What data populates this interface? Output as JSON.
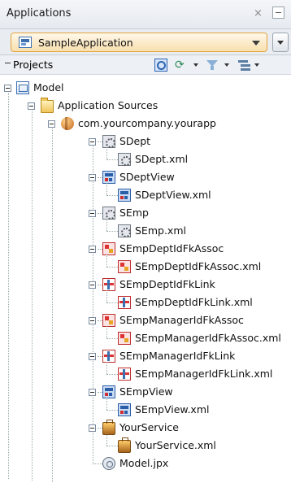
{
  "panel": {
    "title": "Applications",
    "close_glyph": "×"
  },
  "application_selector": {
    "selected": "SampleApplication",
    "icon": "application-icon"
  },
  "projects_bar": {
    "label": "Projects"
  },
  "tree": {
    "model": "Model",
    "application_sources": "Application Sources",
    "package": "com.yourcompany.yourapp",
    "items": [
      {
        "label": "SDept",
        "file": "SDept.xml",
        "icon": "entity-object-icon"
      },
      {
        "label": "SDeptView",
        "file": "SDeptView.xml",
        "icon": "view-object-icon"
      },
      {
        "label": "SEmp",
        "file": "SEmp.xml",
        "icon": "entity-object-icon"
      },
      {
        "label": "SEmpDeptIdFkAssoc",
        "file": "SEmpDeptIdFkAssoc.xml",
        "icon": "association-icon"
      },
      {
        "label": "SEmpDeptIdFkLink",
        "file": "SEmpDeptIdFkLink.xml",
        "icon": "view-link-icon"
      },
      {
        "label": "SEmpManagerIdFkAssoc",
        "file": "SEmpManagerIdFkAssoc.xml",
        "icon": "association-icon"
      },
      {
        "label": "SEmpManagerIdFkLink",
        "file": "SEmpManagerIdFkLink.xml",
        "icon": "view-link-icon"
      },
      {
        "label": "SEmpView",
        "file": "SEmpView.xml",
        "icon": "view-object-icon"
      },
      {
        "label": "YourService",
        "file": "YourService.xml",
        "icon": "application-module-icon"
      }
    ],
    "model_jpx": "Model.jpx"
  },
  "colors": {
    "selector_border": "#e3a33b",
    "selector_fill": "#f8dfae",
    "toolbar_bg": "#e9edf2"
  }
}
